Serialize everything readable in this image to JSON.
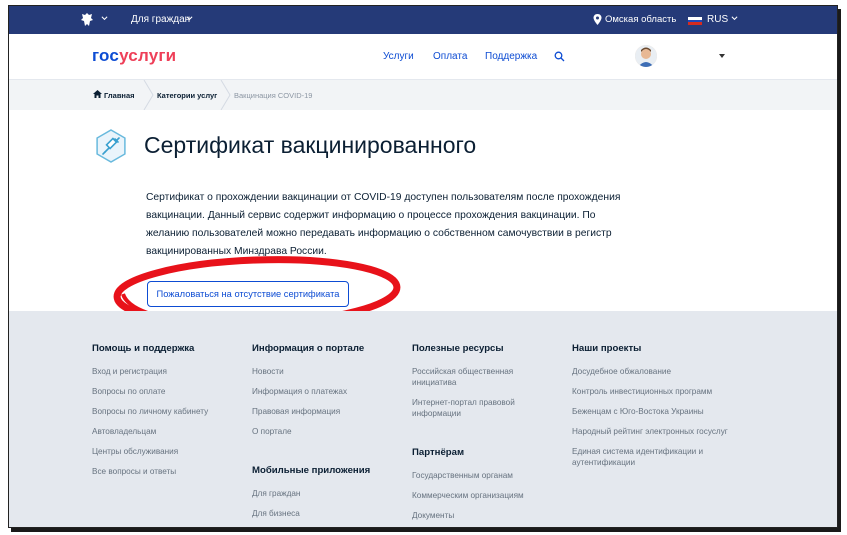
{
  "topbar": {
    "menu_label": "Для граждан",
    "region": "Омская область",
    "lang": "RUS",
    "colors": {
      "bg": "#253a78"
    }
  },
  "header": {
    "logo_part1": "гос",
    "logo_part2": "услуги",
    "nav": [
      "Услуги",
      "Оплата",
      "Поддержка"
    ],
    "icons": [
      "search-icon",
      "avatar",
      "caret-down-icon"
    ]
  },
  "breadcrumbs": {
    "home": "Главная",
    "category": "Категории услуг",
    "current": "Вакцинация COVID-19"
  },
  "main": {
    "title": "Сертификат вакцинированного",
    "description": "Сертификат о прохождении вакцинации от COVID-19 доступен пользователям после прохождения вакцинации. Данный сервис содержит информацию о процессе прохождения вакцинации. По желанию пользователей можно передавать информацию о собственном самочувствии в регистр вакцинированных Минздрава России.",
    "button": "Пожаловаться на отсутствие сертификата",
    "colors": {
      "accent": "#0d4cd3",
      "annotation": "#e8121a"
    }
  },
  "footer": {
    "columns": [
      {
        "title": "Помощь и поддержка",
        "links": [
          "Вход и регистрация",
          "Вопросы по оплате",
          "Вопросы по личному кабинету",
          "Автовладельцам",
          "Центры обслуживания",
          "Все вопросы и ответы"
        ]
      },
      {
        "title": "Информация о портале",
        "links": [
          "Новости",
          "Информация о платежах",
          "Правовая информация",
          "О портале"
        ],
        "sub_title": "Мобильные приложения",
        "sub_links": [
          "Для граждан",
          "Для бизнеса"
        ]
      },
      {
        "title": "Полезные ресурсы",
        "links": [
          "Российская общественная инициатива",
          "Интернет-портал правовой информации"
        ],
        "sub_title": "Партнёрам",
        "sub_links": [
          "Государственным органам",
          "Коммерческим организациям",
          "Документы"
        ]
      },
      {
        "title": "Наши проекты",
        "links": [
          "Досудебное обжалование",
          "Контроль инвестиционных программ",
          "Беженцам с Юго-Востока Украины",
          "Народный рейтинг электронных госуслуг",
          "Единая система идентификации и аутентификации"
        ]
      }
    ]
  }
}
